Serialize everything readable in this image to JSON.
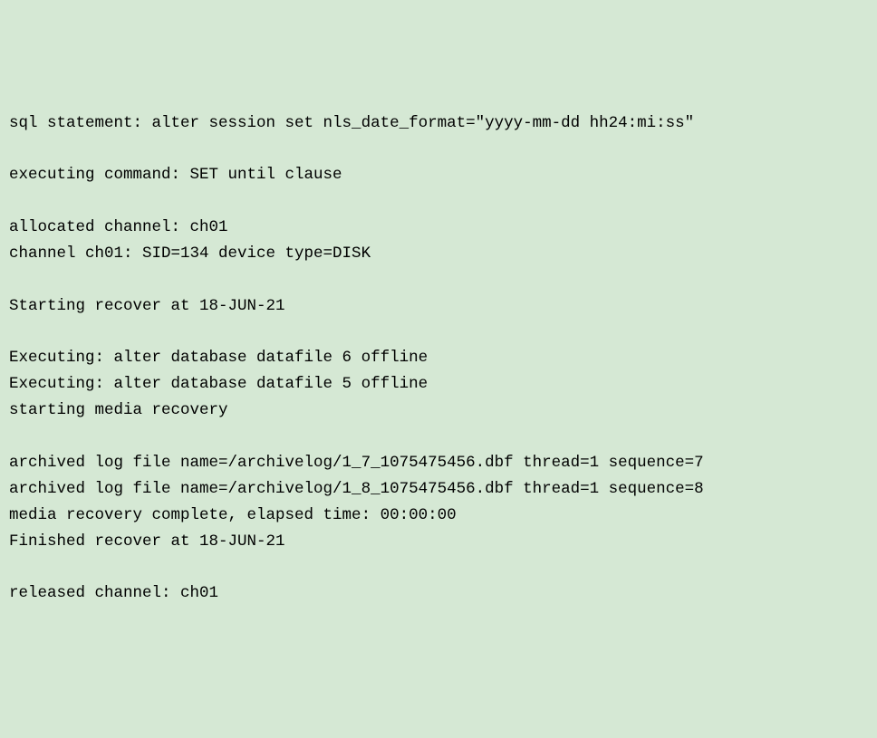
{
  "lines": {
    "l0": "sql statement: alter session set nls_date_format=\"yyyy-mm-dd hh24:mi:ss\"",
    "l1": "",
    "l2": "executing command: SET until clause",
    "l3": "",
    "l4": "allocated channel: ch01",
    "l5": "channel ch01: SID=134 device type=DISK",
    "l6": "",
    "l7": "Starting recover at 18-JUN-21",
    "l8": "",
    "l9": "Executing: alter database datafile 6 offline",
    "l10": "Executing: alter database datafile 5 offline",
    "l11": "starting media recovery",
    "l12": "",
    "l13": "archived log file name=/archivelog/1_7_1075475456.dbf thread=1 sequence=7",
    "l14": "archived log file name=/archivelog/1_8_1075475456.dbf thread=1 sequence=8",
    "l15": "media recovery complete, elapsed time: 00:00:00",
    "l16": "Finished recover at 18-JUN-21",
    "l17": "",
    "l18": "released channel: ch01"
  }
}
